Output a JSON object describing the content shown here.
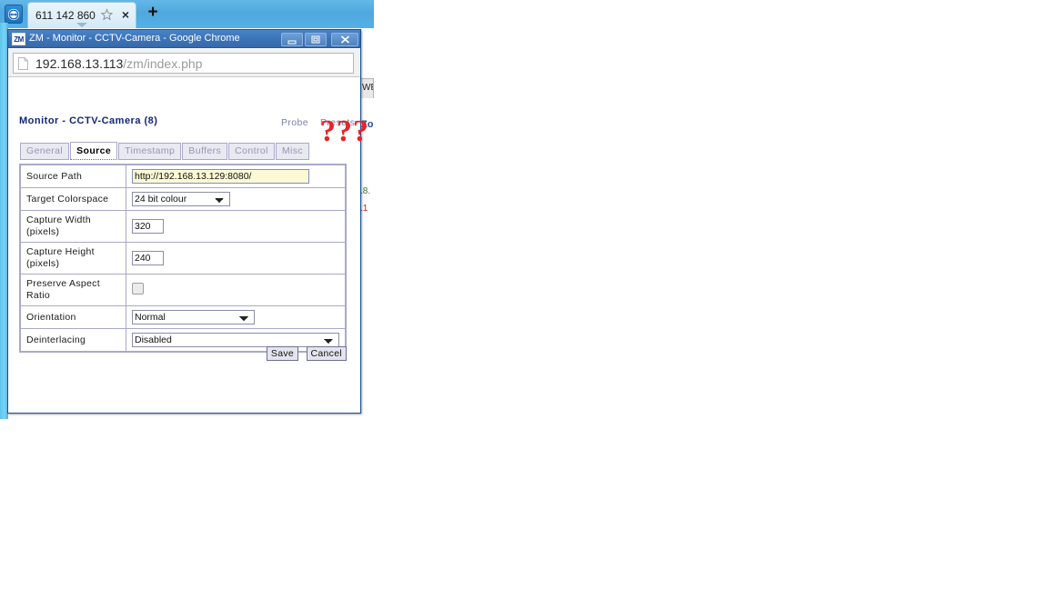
{
  "teamviewer": {
    "app_icon": "teamviewer-icon",
    "tab_label": "611 142 860",
    "star_icon": "bookmark-star-icon",
    "close_icon": "×",
    "newtab_icon": "+"
  },
  "chrome": {
    "favicon_text": "ZM",
    "title": "ZM - Monitor - CCTV-Camera - Google Chrome",
    "minimize_icon": "minimize-icon",
    "maximize_icon": "maximize-icon",
    "close_icon": "close-icon",
    "address": {
      "page_icon": "page-document-icon",
      "host": "192.168.13.113",
      "path": "/zm/index.php"
    }
  },
  "zoneminder": {
    "page_title": "Monitor - CCTV-Camera (8)",
    "header_links": [
      {
        "label": "Probe"
      },
      {
        "label": "Presets"
      }
    ],
    "tabs": [
      {
        "label": "General",
        "active": false
      },
      {
        "label": "Source",
        "active": true
      },
      {
        "label": "Timestamp",
        "active": false
      },
      {
        "label": "Buffers",
        "active": false
      },
      {
        "label": "Control",
        "active": false
      },
      {
        "label": "Misc",
        "active": false
      }
    ],
    "form": {
      "rows": [
        {
          "label": "Source Path",
          "value": "http://192.168.13.129:8080/"
        },
        {
          "label": "Target Colorspace",
          "value": "24 bit colour"
        },
        {
          "label": "Capture Width (pixels)",
          "label_line1": "Capture Width",
          "label_line2": "(pixels)",
          "value": "320"
        },
        {
          "label": "Capture Height (pixels)",
          "label_line1": "Capture Height",
          "label_line2": "(pixels)",
          "value": "240"
        },
        {
          "label": "Preserve Aspect Ratio",
          "label_line1": "Preserve Aspect",
          "label_line2": "Ratio",
          "value": "unchecked"
        },
        {
          "label": "Orientation",
          "value": "Normal"
        },
        {
          "label": "Deinterlacing",
          "value": "Disabled"
        }
      ],
      "colorspace_options": [
        "24 bit colour"
      ],
      "orientation_options": [
        "Normal"
      ],
      "deinterlacing_options": [
        "Disabled"
      ]
    },
    "buttons": {
      "save": "Save",
      "cancel": "Cancel"
    }
  },
  "background_page": {
    "tab_fragment": "WE",
    "heading_fragment": "Zo",
    "text_fragment_1": ".8.",
    "text_fragment_2": ".1"
  },
  "annotation": {
    "marks": [
      "?",
      "?",
      "?"
    ],
    "color": "#e8232a"
  }
}
